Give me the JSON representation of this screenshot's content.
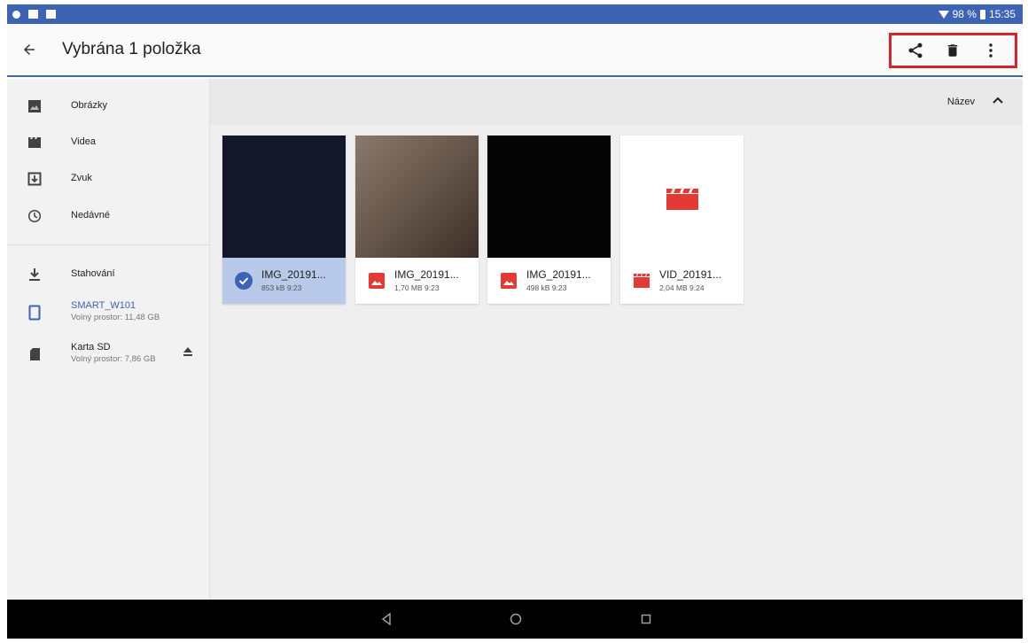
{
  "status_bar": {
    "battery": "98 %",
    "time": "15:35"
  },
  "toolbar": {
    "title": "Vybrána 1 položka"
  },
  "sidebar": {
    "items": [
      {
        "label": "Obrázky",
        "icon": "image-icon"
      },
      {
        "label": "Videa",
        "icon": "video-icon"
      },
      {
        "label": "Zvuk",
        "icon": "audio-icon"
      },
      {
        "label": "Nedávné",
        "icon": "clock-icon"
      },
      {
        "label": "Stahování",
        "icon": "download-icon"
      },
      {
        "label": "SMART_W101",
        "sub": "Volný prostor: 11,48 GB",
        "icon": "tablet-icon",
        "active": true
      },
      {
        "label": "Karta SD",
        "sub": "Volný prostor: 7,86 GB",
        "icon": "sd-card-icon"
      }
    ]
  },
  "sort": {
    "label": "Název"
  },
  "files": [
    {
      "name": "IMG_20191...",
      "meta": "853 kB 9:23",
      "type": "image",
      "selected": true
    },
    {
      "name": "IMG_20191...",
      "meta": "1,70 MB 9:23",
      "type": "image",
      "selected": false
    },
    {
      "name": "IMG_20191...",
      "meta": "498 kB 9:23",
      "type": "image",
      "selected": false
    },
    {
      "name": "VID_20191...",
      "meta": "2,04 MB 9:24",
      "type": "video",
      "selected": false
    }
  ],
  "colors": {
    "accent": "#3d63b5",
    "highlight": "#d8232a",
    "selection": "#b9c9ea",
    "file_red": "#e53935"
  }
}
